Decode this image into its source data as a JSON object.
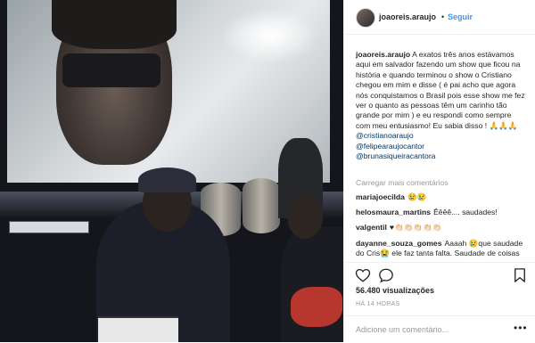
{
  "post": {
    "username": "joaoreis.araujo",
    "separator": "•",
    "follow_label": "Seguir"
  },
  "caption": {
    "author": "joaoreis.araujo",
    "text": "A exatos três anos estávamos aqui em salvador fazendo um show que ficou na história e quando terminou o show o Cristiano chegou em mim e disse ( é pai acho que agora nós conquistamos o Brasil pois esse show me fez ver o quanto as pessoas têm um carinho tão grande por mim ) e eu respondi como sempre com meu entusiasmo! Eu sabia disso ! 🙏🙏🙏",
    "mentions": [
      "@cristianoaraujo",
      "@felipearaujocantor",
      "@brunasiqueiracantora"
    ]
  },
  "load_more_label": "Carregar mais comentários",
  "comments": [
    {
      "author": "mariajoecilda",
      "text": "😢😢"
    },
    {
      "author": "helosmaura_martins",
      "text": "Êêêê.... saudades!"
    },
    {
      "author": "valgentil",
      "text": "♥👏🏻👏🏻👏🏻👏🏻👏🏻"
    },
    {
      "author": "dayanne_souza_gomes",
      "text": "Aaaah 😢que saudade do Cris😭 ele faz tanta falta. Saudade de coisas constantes que só ele"
    }
  ],
  "actions": {
    "like_icon": "heart-icon",
    "comment_icon": "comment-bubble-icon",
    "save_icon": "bookmark-icon"
  },
  "views": "56.480 visualizações",
  "timestamp": "HÁ 14 HORAS",
  "add_comment": {
    "placeholder": "Adicione um comentário...",
    "more_label": "•••"
  }
}
